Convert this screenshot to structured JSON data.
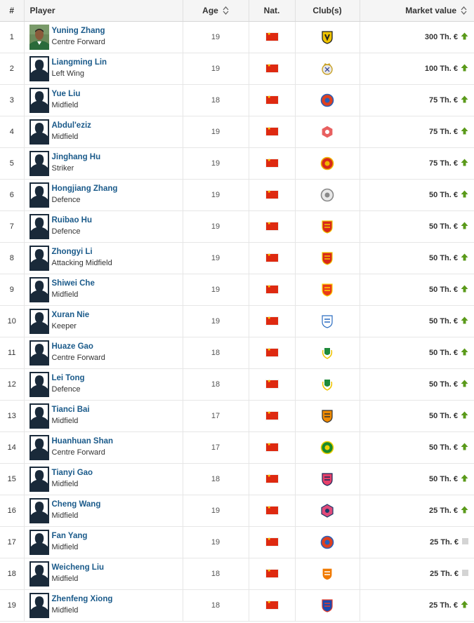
{
  "headers": {
    "num": "#",
    "player": "Player",
    "age": "Age",
    "nat": "Nat.",
    "club": "Club(s)",
    "mv": "Market value"
  },
  "colors": {
    "link": "#1a5a8a",
    "up": "#5a9a1a",
    "flag": "#de2910",
    "neutral": "#d4d4d4"
  },
  "players": [
    {
      "num": "1",
      "name": "Yuning Zhang",
      "pos": "Centre Forward",
      "age": "19",
      "mv": "300 Th. €",
      "trend": "up",
      "club_icon": "vitesse-crest",
      "club_colors": [
        "#f0c400",
        "#222222"
      ],
      "photo": "real"
    },
    {
      "num": "2",
      "name": "Liangming Lin",
      "pos": "Left Wing",
      "age": "19",
      "mv": "100 Th. €",
      "trend": "up",
      "club_icon": "real-madrid-crest",
      "club_colors": [
        "#e8e8e8",
        "#c9a227"
      ]
    },
    {
      "num": "3",
      "name": "Yue Liu",
      "pos": "Midfield",
      "age": "18",
      "mv": "75 Th. €",
      "trend": "up",
      "club_icon": "round-red-blue-crest",
      "club_colors": [
        "#e0401e",
        "#2a5fb8"
      ]
    },
    {
      "num": "4",
      "name": "Abdul'eziz",
      "pos": "Midfield",
      "age": "19",
      "mv": "75 Th. €",
      "trend": "up",
      "club_icon": "red-hexagon-crest",
      "club_colors": [
        "#e86060",
        "#ffffff"
      ]
    },
    {
      "num": "5",
      "name": "Jinghang Hu",
      "pos": "Striker",
      "age": "19",
      "mv": "75 Th. €",
      "trend": "up",
      "club_icon": "red-round-crest",
      "club_colors": [
        "#d8281a",
        "#f0b400"
      ]
    },
    {
      "num": "6",
      "name": "Hongjiang Zhang",
      "pos": "Defence",
      "age": "19",
      "mv": "50 Th. €",
      "trend": "up",
      "club_icon": "grey-ball-crest",
      "club_colors": [
        "#e8e8e8",
        "#888888"
      ]
    },
    {
      "num": "7",
      "name": "Ruibao Hu",
      "pos": "Defence",
      "age": "19",
      "mv": "50 Th. €",
      "trend": "up",
      "club_icon": "red-shield-crest",
      "club_colors": [
        "#d8281a",
        "#f0c400"
      ]
    },
    {
      "num": "8",
      "name": "Zhongyi Li",
      "pos": "Attacking Midfield",
      "age": "19",
      "mv": "50 Th. €",
      "trend": "up",
      "club_icon": "red-shield-crest",
      "club_colors": [
        "#d8281a",
        "#f0c400"
      ]
    },
    {
      "num": "9",
      "name": "Shiwei Che",
      "pos": "Midfield",
      "age": "19",
      "mv": "50 Th. €",
      "trend": "up",
      "club_icon": "red-crown-shield-crest",
      "club_colors": [
        "#e83a1a",
        "#ffd000"
      ]
    },
    {
      "num": "10",
      "name": "Xuran Nie",
      "pos": "Keeper",
      "age": "19",
      "mv": "50 Th. €",
      "trend": "up",
      "club_icon": "blue-white-shield-crest",
      "club_colors": [
        "#ffffff",
        "#2a6cc0"
      ]
    },
    {
      "num": "11",
      "name": "Huaze Gao",
      "pos": "Centre Forward",
      "age": "18",
      "mv": "50 Th. €",
      "trend": "up",
      "club_icon": "green-wreath-crest",
      "club_colors": [
        "#1e8a3a",
        "#f0c400"
      ]
    },
    {
      "num": "12",
      "name": "Lei Tong",
      "pos": "Defence",
      "age": "18",
      "mv": "50 Th. €",
      "trend": "up",
      "club_icon": "green-wreath-crest",
      "club_colors": [
        "#1e8a3a",
        "#f0c400"
      ]
    },
    {
      "num": "13",
      "name": "Tianci Bai",
      "pos": "Midfield",
      "age": "17",
      "mv": "50 Th. €",
      "trend": "up",
      "club_icon": "orange-tiger-shield-crest",
      "club_colors": [
        "#f08a00",
        "#333333"
      ]
    },
    {
      "num": "14",
      "name": "Huanhuan Shan",
      "pos": "Centre Forward",
      "age": "17",
      "mv": "50 Th. €",
      "trend": "up",
      "club_icon": "green-yellow-round-crest",
      "club_colors": [
        "#1a8a2a",
        "#f0d000"
      ]
    },
    {
      "num": "15",
      "name": "Tianyi Gao",
      "pos": "Midfield",
      "age": "18",
      "mv": "50 Th. €",
      "trend": "up",
      "club_icon": "pink-navy-crest",
      "club_colors": [
        "#e8406a",
        "#1a2a5a"
      ]
    },
    {
      "num": "16",
      "name": "Cheng Wang",
      "pos": "Midfield",
      "age": "19",
      "mv": "25 Th. €",
      "trend": "up",
      "club_icon": "pink-star-crest",
      "club_colors": [
        "#e04a7a",
        "#1a3a6a"
      ]
    },
    {
      "num": "17",
      "name": "Fan Yang",
      "pos": "Midfield",
      "age": "19",
      "mv": "25 Th. €",
      "trend": "neutral",
      "club_icon": "round-red-blue-crest",
      "club_colors": [
        "#e0401e",
        "#2a5fb8"
      ]
    },
    {
      "num": "18",
      "name": "Weicheng Liu",
      "pos": "Midfield",
      "age": "18",
      "mv": "25 Th. €",
      "trend": "neutral",
      "club_icon": "orange-shield-crest",
      "club_colors": [
        "#f07a00",
        "#ffffff"
      ]
    },
    {
      "num": "19",
      "name": "Zhenfeng Xiong",
      "pos": "Midfield",
      "age": "18",
      "mv": "25 Th. €",
      "trend": "up",
      "club_icon": "blue-striped-shield-crest",
      "club_colors": [
        "#1a4ab0",
        "#e03a2a"
      ]
    }
  ]
}
